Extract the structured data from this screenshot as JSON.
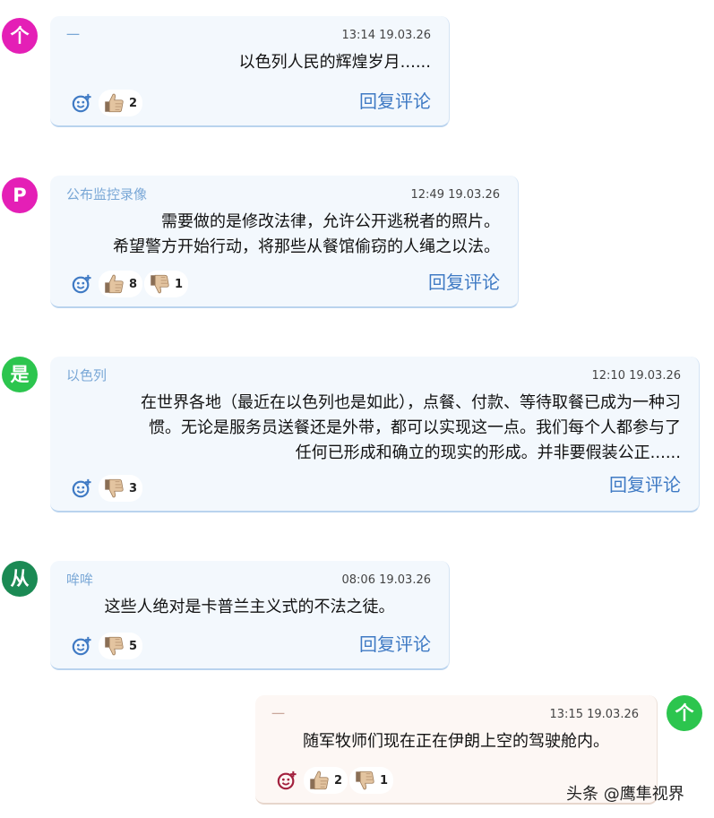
{
  "comments": [
    {
      "avatar_letter": "个",
      "avatar_color": "#e41fb6",
      "author": "一",
      "time": "13:14 19.03.26",
      "lines": [
        "以色列人民的辉煌岁月......"
      ],
      "likes": "2",
      "reply_label": "回复评论"
    },
    {
      "avatar_letter": "P",
      "avatar_color": "#e41fb6",
      "author": "公布监控录像",
      "time": "12:49 19.03.26",
      "lines": [
        "需要做的是修改法律，允许公开逃税者的照片。",
        "希望警方开始行动，将那些从餐馆偷窃的人绳之以法。"
      ],
      "likes": "8",
      "dislikes": "1",
      "reply_label": "回复评论"
    },
    {
      "avatar_letter": "是",
      "avatar_color": "#2cc54e",
      "author": "以色列",
      "time": "12:10 19.03.26",
      "lines": [
        "在世界各地（最近在以色列也是如此），点餐、付款、等待取餐已成为一种习",
        "惯。无论是服务员送餐还是外带，都可以实现这一点。我们每个人都参与了",
        "任何已形成和确立的现实的形成。并非要假装公正......"
      ],
      "dislikes": "3",
      "reply_label": "回复评论"
    },
    {
      "avatar_letter": "从",
      "avatar_color": "#1b8a54",
      "author": "哞哞",
      "time": "08:06 19.03.26",
      "lines": [
        "这些人绝对是卡普兰主义式的不法之徒。"
      ],
      "dislikes": "5",
      "reply_label": "回复评论"
    },
    {
      "avatar_letter": "个",
      "avatar_color": "#2cc54e",
      "author": "一",
      "time": "13:15 19.03.26",
      "lines": [
        "随军牧师们现在正在伊朗上空的驾驶舱内。"
      ],
      "likes": "2",
      "dislikes": "1"
    }
  ],
  "watermark": "头条 @鹰隼视界",
  "icons": {
    "add_reaction": "add-reaction-icon",
    "like": "thumbs-up-icon",
    "dislike": "thumbs-down-icon"
  },
  "colors": {
    "bubble": "#f3f8fd",
    "bubble_mine": "#fdf7f4",
    "reply": "#3f7ac4",
    "author": "#79a7d6"
  }
}
